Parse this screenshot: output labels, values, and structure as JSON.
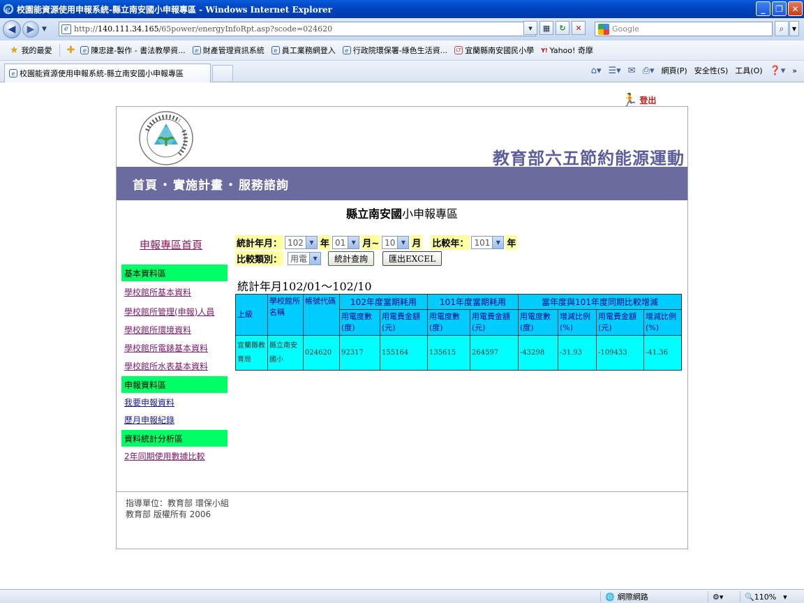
{
  "window": {
    "title": "校園能資源使用申報系統-縣立南安國小申報專區 - Windows Internet Explorer",
    "controls": {
      "minimize": "_",
      "restore": "❐",
      "close": "✕"
    }
  },
  "address": {
    "url_prefix": "http://",
    "url_host": "140.111.34.165",
    "url_path": "/65power/energyInfoRpt.asp?scode=024620",
    "search_placeholder": "Google"
  },
  "favorites": {
    "label": "我的最愛",
    "items": [
      {
        "label": "陳忠建-製作 - 書法教學資...",
        "icon": "ie-icon"
      },
      {
        "label": "財產管理資訊系統",
        "icon": "ie-icon"
      },
      {
        "label": "員工業務網登入",
        "icon": "ie-icon"
      },
      {
        "label": "行政院環保署-綠色生活資...",
        "icon": "ie-icon"
      },
      {
        "label": "宜蘭縣南安國民小學",
        "icon": "lt-icon"
      },
      {
        "label": "Yahoo! 奇摩",
        "icon": "yahoo-icon"
      }
    ]
  },
  "tab": {
    "label": "校園能資源使用申報系統-縣立南安國小申報專區"
  },
  "commands": {
    "page": "網頁(P)",
    "safety": "安全性(S)",
    "tools": "工具(O)"
  },
  "logout": "登出",
  "header": {
    "slogan": "教育部六五節約能源運動",
    "nav": {
      "home": "首頁",
      "plan": "實施計畫",
      "service": "服務諮詢",
      "sep": "・"
    }
  },
  "page_heading": {
    "bold": "縣立南安國",
    "rest": "小申報專區"
  },
  "sidebar": {
    "home": "申報專區首頁",
    "sections": [
      {
        "title": "基本資料區",
        "links": [
          "學校館所基本資料",
          "學校館所管理(申報)人員",
          "學校館所環境資料",
          "學校館所電錶基本資料",
          "學校館所水表基本資料"
        ]
      },
      {
        "title": "申報資料區",
        "links": [
          "我要申報資料",
          "歷月申報紀錄"
        ]
      },
      {
        "title": "資料統計分析區",
        "links": [
          "2年同期使用數據比較"
        ]
      }
    ]
  },
  "form": {
    "stat_label": "統計年月：",
    "year": "102",
    "year_unit": "年",
    "month_from": "01",
    "month_sep": "月~",
    "month_to": "10",
    "month_unit": "月",
    "compare_label": "比較年：",
    "compare_year": "101",
    "compare_unit": "年",
    "type_label": "比較類別：",
    "type_value": "用電",
    "query_button": "統計查詢",
    "export_button": "匯出EXCEL"
  },
  "stat_title": "統計年月102/01～102/10",
  "table": {
    "headers": {
      "upper": "上級",
      "school": "學校館所名稱",
      "account": "帳號代碼",
      "grp_current": "102年度當期耗用",
      "grp_previous": "101年度當期耗用",
      "grp_compare": "當年度與101年度同期比較增減",
      "kwh": "用電度數(度)",
      "fee": "用電費金額(元)",
      "ratio": "增減比例(%)"
    },
    "row": {
      "upper": "宜蘭縣教育局",
      "school": "縣立南安國小",
      "account": "024620",
      "cur_kwh": "92317",
      "cur_fee": "155164",
      "prev_kwh": "135615",
      "prev_fee": "264597",
      "diff_kwh": "-43298",
      "diff_kwh_pct": "-31.93",
      "diff_fee": "-109433",
      "diff_fee_pct": "-41.36"
    }
  },
  "footer": {
    "line1": "指導單位：教育部 環保小組",
    "line2": "教育部 版權所有 2006"
  },
  "status": {
    "zone": "網際網路",
    "zoom": "110%"
  }
}
